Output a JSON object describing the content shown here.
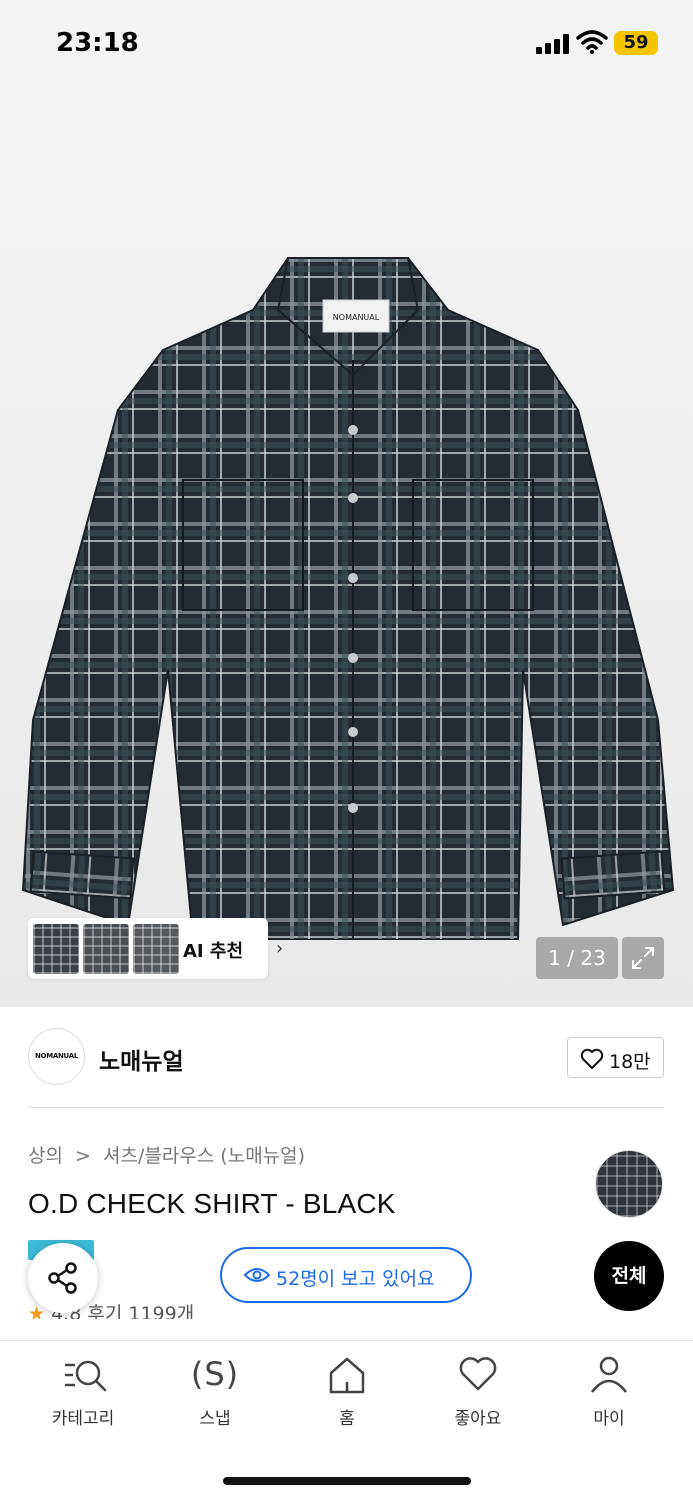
{
  "status_bar": {
    "time": "23:18",
    "battery": "59"
  },
  "gallery": {
    "ai_label": "AI 추천",
    "counter": "1 / 23",
    "shirt_tag": "NOMANUAL"
  },
  "brand": {
    "logo_text": "NOMANUAL",
    "name": "노매뉴얼",
    "likes": "18만"
  },
  "breadcrumb": [
    "상의",
    ">",
    "셔츠/블라우스 (노매뉴얼)"
  ],
  "product": {
    "title": "O.D CHECK SHIRT - BLACK"
  },
  "rating": {
    "score": "4.8",
    "review_text": "후기 1199개"
  },
  "floating": {
    "viewers": "52명이 보고 있어요",
    "all_button": "전체"
  },
  "tabs": [
    {
      "label": "카테고리",
      "icon": "category-search-icon"
    },
    {
      "label": "스냅",
      "icon": "snap-icon",
      "glyph": "(S)"
    },
    {
      "label": "홈",
      "icon": "home-icon"
    },
    {
      "label": "좋아요",
      "icon": "heart-icon"
    },
    {
      "label": "마이",
      "icon": "person-icon"
    }
  ],
  "colors": {
    "accent_blue": "#1d6be8",
    "star": "#f39a1b",
    "battery": "#f5c400"
  }
}
